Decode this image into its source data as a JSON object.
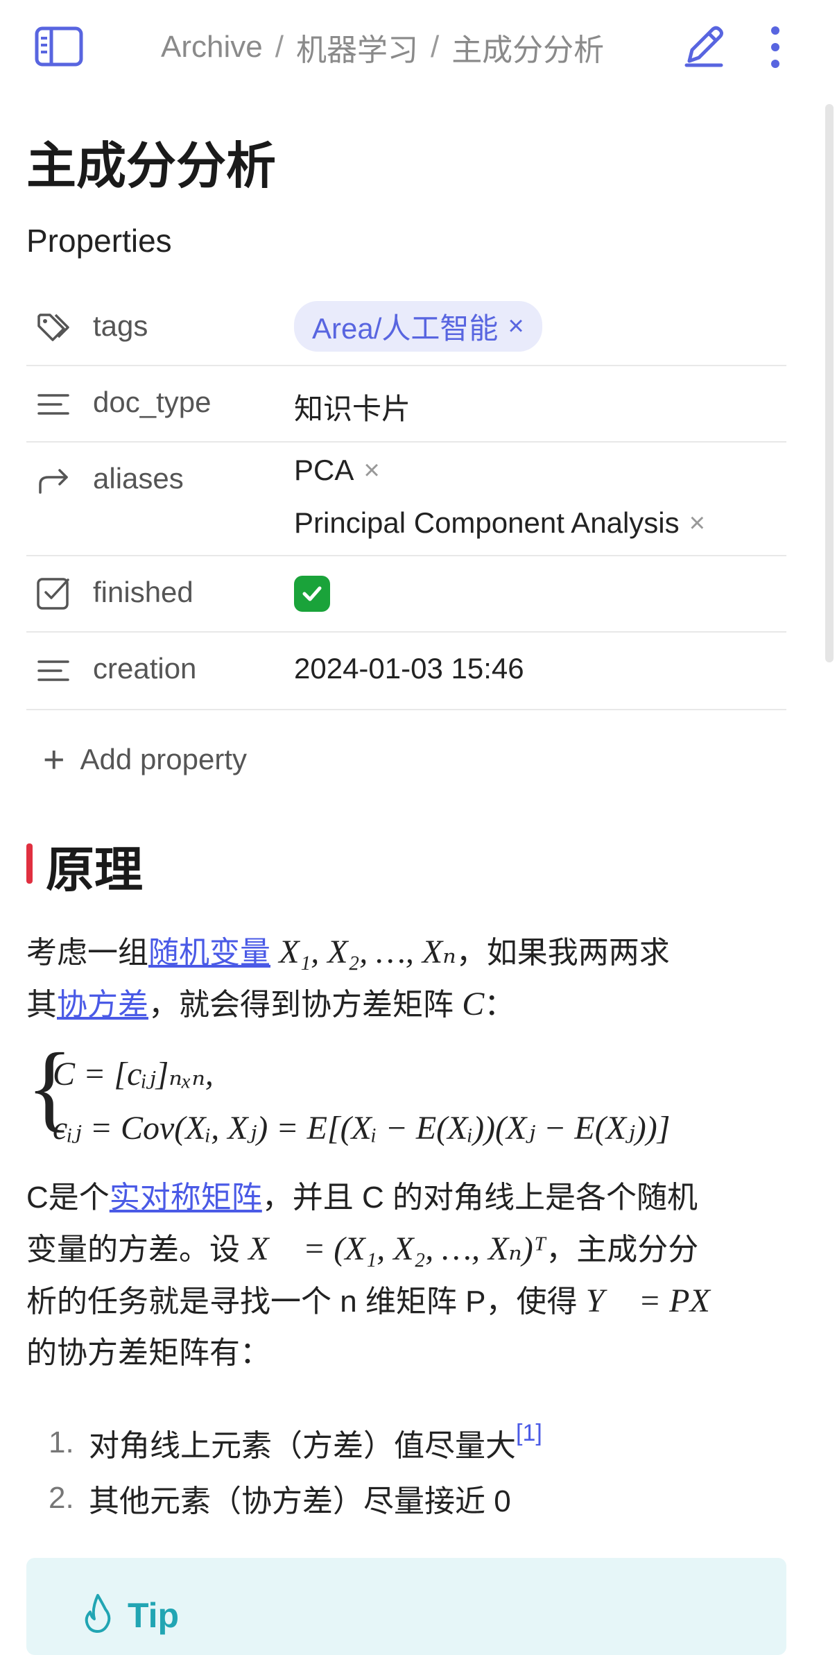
{
  "header": {
    "breadcrumb": [
      "Archive",
      "机器学习",
      "主成分分析"
    ],
    "separator": "/"
  },
  "title": "主成分分析",
  "properties": {
    "heading": "Properties",
    "tags": {
      "key": "tags",
      "value": "Area/人工智能",
      "remove": "×"
    },
    "doc_type": {
      "key": "doc_type",
      "value": "知识卡片"
    },
    "aliases": {
      "key": "aliases",
      "values": [
        "PCA",
        "Principal Component Analysis"
      ],
      "remove": "×"
    },
    "finished": {
      "key": "finished",
      "checked": true
    },
    "creation": {
      "key": "creation",
      "value": "2024-01-03 15:46"
    },
    "add_label": "Add property"
  },
  "section": {
    "heading": "原理",
    "p1": {
      "t1": "考虑一组",
      "link1": "随机变量",
      "m1": "X₁, X₂, …, Xₙ",
      "t2": "，如果我两两求",
      "t3": "其",
      "link2": "协方差",
      "t4": "，就会得到协方差矩阵",
      "m2": "C",
      "t5": "："
    },
    "equation": {
      "line1": "C = [cᵢⱼ]ₙₓₙ,",
      "line2": "cᵢⱼ = Cov(Xᵢ, Xⱼ) = E[(Xᵢ − E(Xᵢ))(Xⱼ − E(Xⱼ))]"
    },
    "p2": {
      "t1": "C是个",
      "link1": "实对称矩阵",
      "t2": "，并且 C 的对角线上是各个随机",
      "t3": "变量的方差。设",
      "m1": "X⃗ = (X₁, X₂, …, Xₙ)ᵀ",
      "t4": "，主成分分",
      "t5": "析的任务就是寻找一个 n 维矩阵 P，使得",
      "m2": "Y⃗ = PX⃗",
      "t6": "的协方差矩阵有："
    },
    "list": [
      {
        "num": "1.",
        "text": "对角线上元素（方差）值尽量大",
        "footnote": "[1]"
      },
      {
        "num": "2.",
        "text": "其他元素（协方差）尽量接近 0",
        "footnote": ""
      }
    ],
    "callout": {
      "label": "Tip"
    }
  },
  "colors": {
    "accent": "#5865e0",
    "link": "#4a5ae6",
    "heading_bar": "#e03040",
    "check": "#1aa33a",
    "tip": "#21a5b3",
    "tip_bg": "#e6f6f8"
  }
}
